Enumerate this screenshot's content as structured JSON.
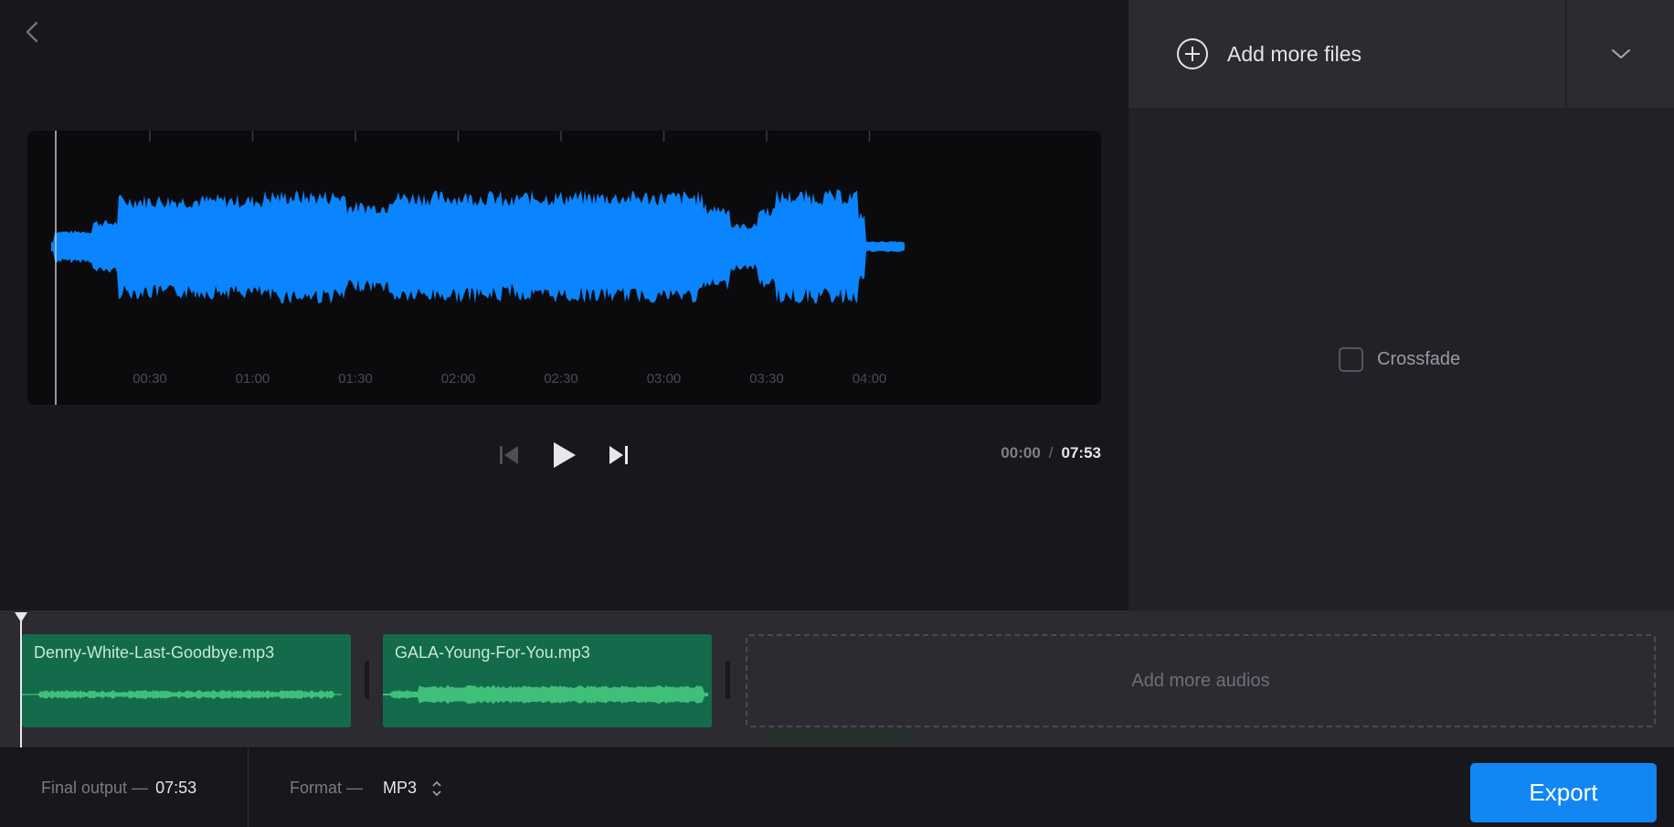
{
  "colors": {
    "waveform": "#0a84ff",
    "clip": "#146b4b",
    "clip_wave": "#3fbf7a",
    "accent": "#1286f2"
  },
  "icons": {
    "back": "chevron-left-icon",
    "add": "plus-circle-icon",
    "dropdown": "chevron-down-icon",
    "prev": "skip-previous-icon",
    "play": "play-icon",
    "next": "skip-next-icon",
    "format_stepper": "up-down-arrows-icon"
  },
  "waveform": {
    "ticks": [
      "00:30",
      "01:00",
      "01:30",
      "02:00",
      "02:30",
      "03:00",
      "03:30",
      "04:00"
    ]
  },
  "player": {
    "current_time": "00:00",
    "separator": "/",
    "total_time": "07:53"
  },
  "side_panel": {
    "add_files_label": "Add more files",
    "crossfade_label": "Crossfade",
    "crossfade_checked": false
  },
  "timeline": {
    "clips": [
      {
        "name": "Denny-White-Last-Goodbye.mp3"
      },
      {
        "name": "GALA-Young-For-You.mp3"
      }
    ],
    "add_audios_label": "Add more audios"
  },
  "footer": {
    "final_output_label": "Final output —",
    "final_output_value": "07:53",
    "format_label": "Format —",
    "format_value": "MP3",
    "export_label": "Export"
  }
}
